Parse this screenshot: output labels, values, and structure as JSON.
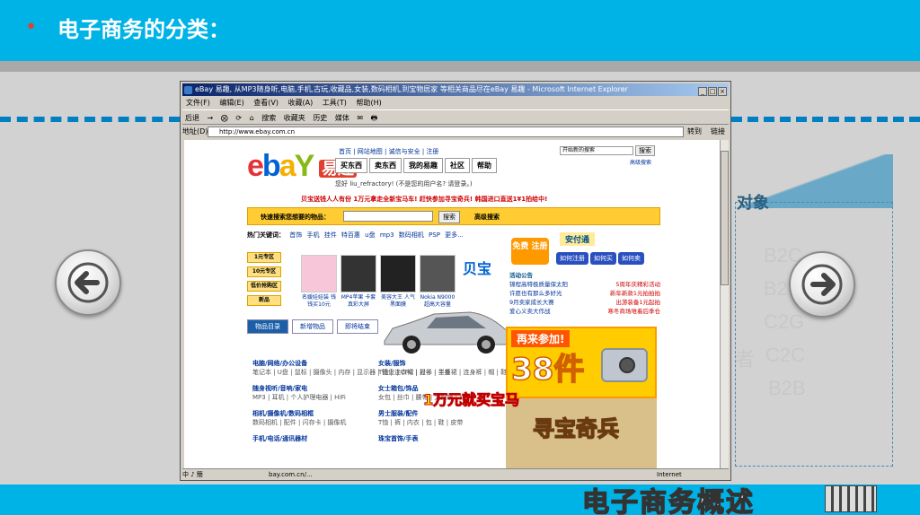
{
  "slide": {
    "bullet": "•",
    "title": "电子商务的分类："
  },
  "bottom_banner": {
    "text": "电子商务概述"
  },
  "right_panel": {
    "target_label": "对象",
    "items": [
      "B2C",
      "B2",
      "C2G",
      "者",
      "C2C",
      "B2B"
    ]
  },
  "nav": {
    "prev_icon": "arrow-left-icon",
    "next_icon": "arrow-right-icon"
  },
  "browser": {
    "title": "eBay 易趣, 从MP3随身听,电脑,手机,古玩,收藏品,女装,数码相机,到宝物居家 等相关商品尽在eBay 易趣 - Microsoft Internet Explorer",
    "menu": [
      "文件(F)",
      "编辑(E)",
      "查看(V)",
      "收藏(A)",
      "工具(T)",
      "帮助(H)"
    ],
    "toolbar": [
      "后退",
      "→",
      "⨂",
      "⟳",
      "⌂",
      "搜索",
      "收藏夹",
      "历史",
      "媒体",
      "✉",
      "🖶"
    ],
    "address_label": "地址(D)",
    "address": "http://www.ebay.com.cn",
    "go_label": "转到",
    "links_label": "链接",
    "status_url": "bay.com.cn/...",
    "status_zone": "Internet",
    "status_left": "中 ♪ 簡"
  },
  "ebay": {
    "logo_cn": "易趣",
    "toplinks": "首页 | 网站地图 | 诚信与安全 | 注册",
    "tabs": [
      "买东西",
      "卖东西",
      "我的易趣",
      "社区",
      "帮助"
    ],
    "search_placeholder": "开始新的搜索",
    "search_btn": "搜索",
    "adv_search": "高级搜索",
    "hello": "您好 liu_refractory! (不是您的用户名? 请登录。)",
    "promo": "贝宝送钱人人有份    1万元拿走全新宝马车! 赶快参加寻宝奇兵!    韩国进口直送1¥1拍给中!",
    "quick_label": "快速搜索您想要的物品：",
    "quick_btn": "搜索",
    "quick_adv": "高级搜索",
    "hot_label": "热门关键词：",
    "hot": [
      "首饰",
      "手机",
      "挂件",
      "特百惠",
      "u盘",
      "mp3",
      "数码相机",
      "PSP",
      "更多..."
    ],
    "left_tags": [
      "1元专区",
      "10元专区",
      "低价抢购区",
      "新品"
    ],
    "products": [
      {
        "cap": "名媛娃娃装 钱钱买10元"
      },
      {
        "cap": "MP4苹果 卡套 真彩大屏"
      },
      {
        "cap": "美容大王 人气黑面膜"
      },
      {
        "cap": "Nokia N9000 超高大容量"
      }
    ],
    "beibao": "贝宝",
    "register": "免费 注册",
    "anxin": "安付通",
    "btns": [
      "如何注册",
      "如何买",
      "如何卖"
    ],
    "news_head": "活动公告",
    "news": [
      [
        "锦程高特极质量保太阳",
        "5周年庆精彩活动"
      ],
      [
        "许愿也有那么多好光",
        "新年新款1元拍拍拍"
      ],
      [
        "9月卖家成长大赛",
        "出游装备1元起拍"
      ],
      [
        "爱心义卖大作战",
        "寒冬商场堆着后季仓"
      ]
    ],
    "cat_tabs": [
      "物品目录",
      "新增物品",
      "即将结束"
    ],
    "cats": [
      {
        "h": "电脑/网络/办公设备",
        "s": "笔记本 | U盘 | 鼠标 | 摄像头 | 内存 | 显示器 | 键盘 | CPU | 显卡 | 主板"
      },
      {
        "h": "随身视听/音响/家电",
        "s": "MP3 | 耳机 | 个人护理电器 | HiFi"
      },
      {
        "h": "相机/摄像机/数码相框",
        "s": "数码相机 | 配件 | 闪存卡 | 摄像机"
      },
      {
        "h": "手机/电话/通讯器材",
        "s": ""
      }
    ],
    "cats2": [
      {
        "h": "女装/服饰",
        "s": "T恤 | 连衣裙 | 衬衫 | 半身裙 | 连身裤 | 帽 | 鞋 | 内衣"
      },
      {
        "h": "女士箱包/饰品",
        "s": "女包 | 丝巾 | 腰带 | 太阳镜 | 袜子"
      },
      {
        "h": "男士服装/配件",
        "s": "T恤 | 裤 | 内衣 | 包 | 鞋 | 皮带"
      },
      {
        "h": "珠宝首饰/手表",
        "s": ""
      }
    ],
    "ad38_add": "再来参加!",
    "ad38_num": "38件",
    "treasure": "寻宝奇兵",
    "wan": "1万元就买宝马"
  }
}
